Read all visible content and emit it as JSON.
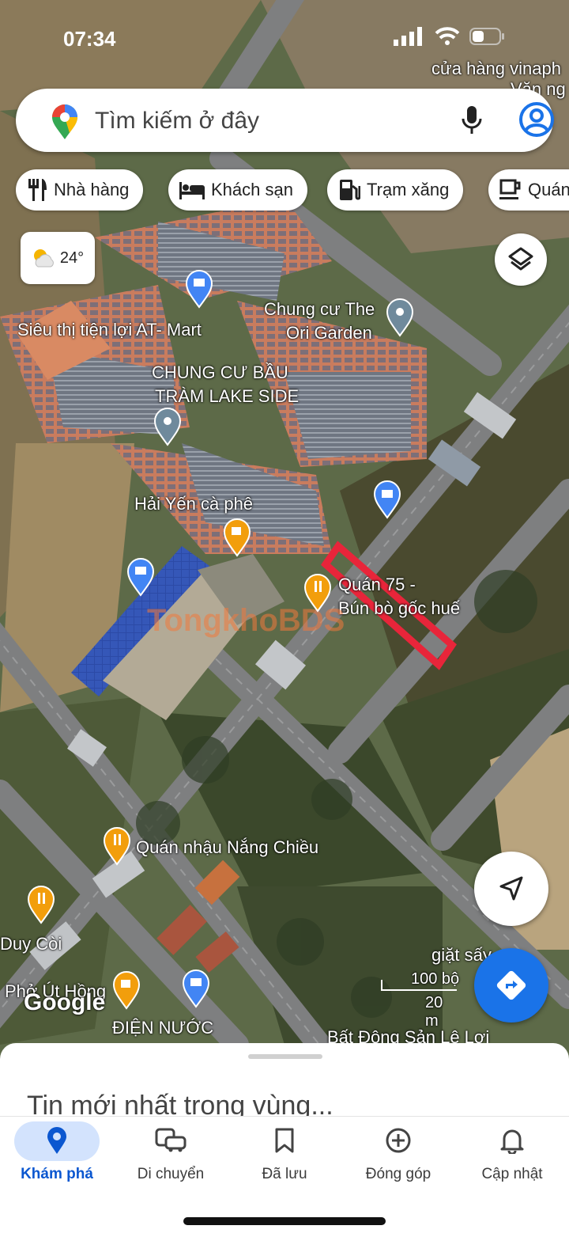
{
  "status_bar": {
    "time": "07:34"
  },
  "search": {
    "placeholder": "Tìm kiếm ở đây"
  },
  "chips": [
    {
      "label": "Nhà hàng",
      "icon": "restaurant-icon"
    },
    {
      "label": "Khách sạn",
      "icon": "hotel-icon"
    },
    {
      "label": "Trạm xăng",
      "icon": "gas-station-icon"
    },
    {
      "label": "Quán",
      "icon": "cafe-icon"
    }
  ],
  "weather": {
    "temp": "24°",
    "icon": "partly-cloudy-icon"
  },
  "map": {
    "labels": [
      {
        "text": "cửa hàng vinaph",
        "kind": "poi"
      },
      {
        "text": "Văn ng",
        "kind": "poi"
      },
      {
        "text": "Siêu thị tiện lợi AT- Mart",
        "kind": "poi"
      },
      {
        "text": "Chung cư The",
        "kind": "poi"
      },
      {
        "text": "Ori Garden",
        "kind": "poi"
      },
      {
        "text": "CHUNG CƯ BẦU",
        "kind": "area"
      },
      {
        "text": "TRÀM LAKE SIDE",
        "kind": "area"
      },
      {
        "text": "Hải Yến cà phê",
        "kind": "poi"
      },
      {
        "text": "Quán 75 -",
        "kind": "poi"
      },
      {
        "text": "Bún bò gốc huế",
        "kind": "poi"
      },
      {
        "text": "Quán nhậu Nắng Chiều",
        "kind": "poi"
      },
      {
        "text": "Duy Còi",
        "kind": "poi"
      },
      {
        "text": "Phở Út Hồng",
        "kind": "poi"
      },
      {
        "text": "ĐIỆN NƯỚC",
        "kind": "poi"
      },
      {
        "text": "giặt sấy",
        "kind": "poi"
      },
      {
        "text": "Bất Động Sản Lê Lợi",
        "kind": "poi"
      }
    ],
    "watermark": "TongkhoBDS",
    "logo": "Google",
    "scale": {
      "imperial": "100 bộ",
      "metric": "20 m"
    }
  },
  "sheet": {
    "title": "Tin mới nhất trong vùng..."
  },
  "nav": [
    {
      "label": "Khám phá",
      "icon": "explore-pin-icon",
      "active": true
    },
    {
      "label": "Di chuyển",
      "icon": "commute-icon",
      "active": false
    },
    {
      "label": "Đã lưu",
      "icon": "bookmark-icon",
      "active": false
    },
    {
      "label": "Đóng góp",
      "icon": "add-circle-icon",
      "active": false
    },
    {
      "label": "Cập nhật",
      "icon": "bell-icon",
      "active": false
    }
  ],
  "colors": {
    "accent": "#1a73e8",
    "highlight": "#e8253a",
    "pin_orange": "#f29e0c",
    "pin_blue": "#4285f4",
    "pin_gray": "#6f8a9c"
  }
}
